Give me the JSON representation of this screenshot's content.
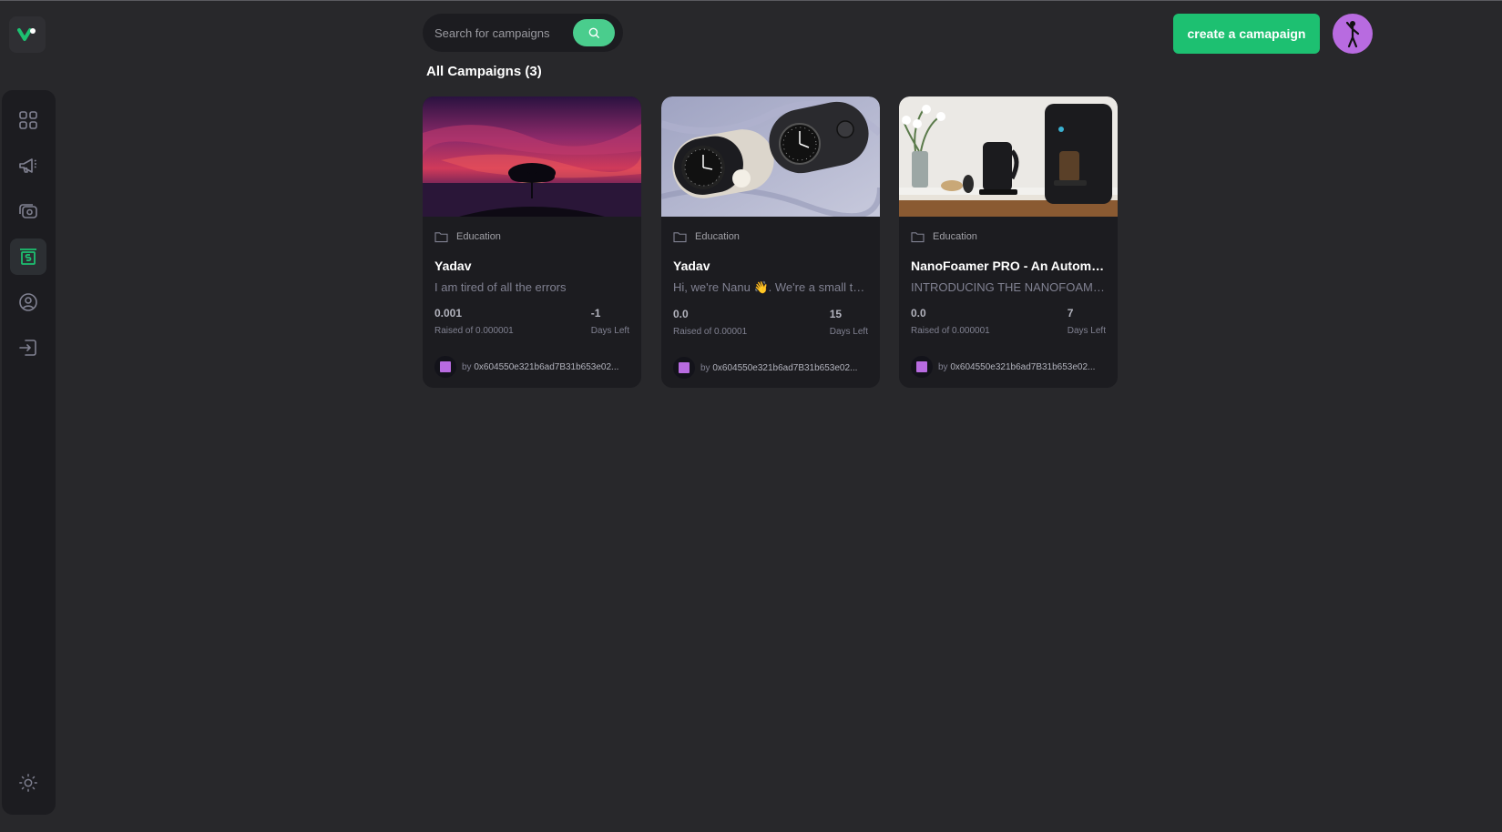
{
  "app": {
    "logo_icon": "logo-icon",
    "accent_color": "#1dc071"
  },
  "sidebar": {
    "items": [
      {
        "name": "dashboard",
        "icon": "dashboard-icon",
        "active": false
      },
      {
        "name": "campaign",
        "icon": "megaphone-icon",
        "active": false
      },
      {
        "name": "payment",
        "icon": "payment-icon",
        "active": false
      },
      {
        "name": "withdraw",
        "icon": "withdraw-icon",
        "active": true
      },
      {
        "name": "profile",
        "icon": "profile-icon",
        "active": false
      },
      {
        "name": "logout",
        "icon": "logout-icon",
        "active": false
      }
    ],
    "theme_icon": "sun-icon"
  },
  "search": {
    "placeholder": "Search for campaigns",
    "value": ""
  },
  "header": {
    "create_label": "create a camapaign"
  },
  "main": {
    "title": "All Campaigns (3)",
    "campaigns": [
      {
        "category": "Education",
        "title": "Yadav",
        "description": "I am tired of all the errors",
        "raised": "0.001",
        "raised_label": "Raised of 0.000001",
        "days": "-1",
        "days_label": "Days Left",
        "owner_prefix": "by ",
        "owner": "0x604550e321b6ad7B31b653e02..."
      },
      {
        "category": "Education",
        "title": "Yadav",
        "description": "Hi, we're Nanu 👋. We're a small team of designers",
        "raised": "0.0",
        "raised_label": "Raised of 0.00001",
        "days": "15",
        "days_label": "Days Left",
        "owner_prefix": "by ",
        "owner": "0x604550e321b6ad7B31b653e02..."
      },
      {
        "category": "Education",
        "title": "NanoFoamer PRO - An Automatic Milk Frother",
        "description": "INTRODUCING THE NANOFOAMER PRO",
        "raised": "0.0",
        "raised_label": "Raised of 0.000001",
        "days": "7",
        "days_label": "Days Left",
        "owner_prefix": "by ",
        "owner": "0x604550e321b6ad7B31b653e02..."
      }
    ]
  }
}
